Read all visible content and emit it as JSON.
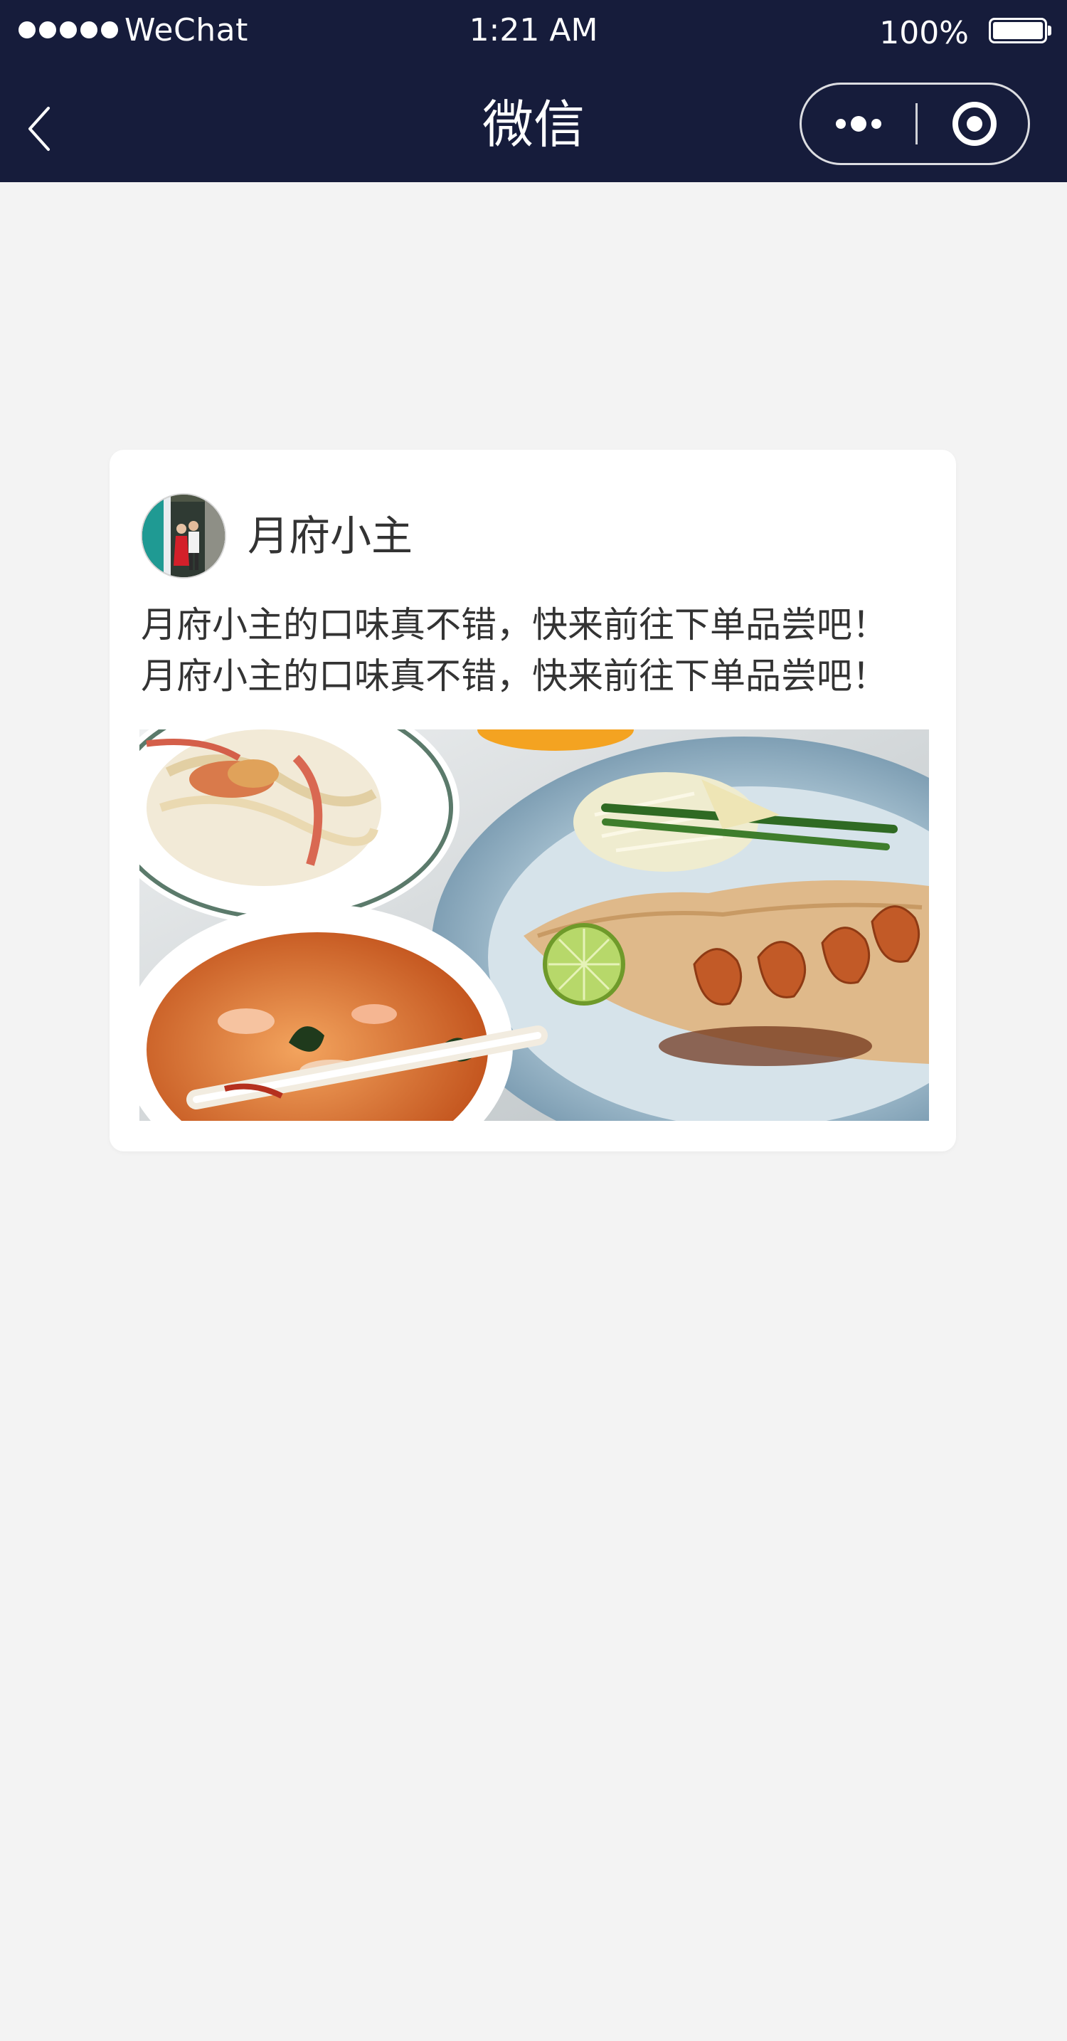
{
  "status_bar": {
    "carrier": "WeChat",
    "time": "1:21 AM",
    "battery_percent": "100%",
    "battery_level": 1.0
  },
  "nav": {
    "title": "微信",
    "back_icon": "chevron-left-icon",
    "more_icon": "more-dots-icon",
    "close_icon": "target-close-icon"
  },
  "post": {
    "author_name": "月府小主",
    "text_lines": [
      "月府小主的口味真不错，快来前往下单品尝吧！",
      "月府小主的口味真不错，快来前往下单品尝吧！"
    ],
    "image_subject": "food-photo"
  },
  "colors": {
    "chrome_bg": "#161c3b",
    "page_bg": "#f3f3f3",
    "card_bg": "#ffffff",
    "text": "#333333"
  }
}
